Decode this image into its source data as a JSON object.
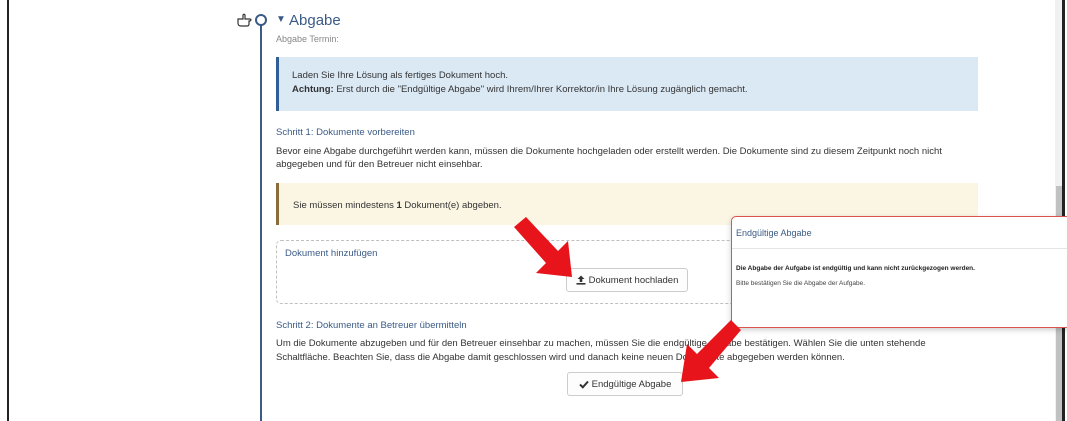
{
  "section": {
    "title": "Abgabe",
    "deadline_label": "Abgabe Termin:"
  },
  "info": {
    "line1": "Laden Sie Ihre Lösung als fertiges Dokument hoch.",
    "attention_label": "Achtung:",
    "attention_text": " Erst durch die \"Endgültige Abgabe\" wird Ihrem/Ihrer Korrektor/in Ihre Lösung zugänglich gemacht."
  },
  "step1": {
    "heading": "Schritt 1: Dokumente vorbereiten",
    "text": "Bevor eine Abgabe durchgeführt werden kann, müssen die Dokumente hochgeladen oder erstellt werden. Die Dokumente sind zu diesem Zeitpunkt noch nicht abgegeben und für den Betreuer nicht einsehbar."
  },
  "warning": {
    "prefix": "Sie müssen mindestens ",
    "count": "1",
    "suffix": " Dokument(e) abgeben."
  },
  "upload": {
    "label": "Dokument hinzufügen",
    "button_label": "Dokument hochladen"
  },
  "step2": {
    "heading": "Schritt 2: Dokumente an Betreuer übermitteln",
    "text": "Um die Dokumente abzugeben und für den Betreuer einsehbar zu machen, müssen Sie die endgültige Abgabe bestätigen. Wählen Sie die unten stehende Schaltfläche. Beachten Sie, dass die Abgabe damit geschlossen wird und danach keine neuen Dokumente abgegeben werden können.",
    "button_label": "Endgültige Abgabe"
  },
  "dialog": {
    "title": "Endgültige Abgabe",
    "message": "Die Abgabe der Aufgabe ist endgültig und kann nicht zurückgezogen werden.",
    "subtext": "Bitte bestätigen Sie die Abgabe der Aufgabe."
  },
  "colors": {
    "accent": "#3b5b86",
    "info_bg": "#dbe9f5",
    "warning_bg": "#fbf6e3",
    "arrow": "#e8141b",
    "dialog_border": "#d9534f"
  },
  "icons": {
    "pointer": "hand-pointer-icon",
    "caret": "caret-down-icon",
    "upload": "upload-icon",
    "check": "check-icon"
  }
}
